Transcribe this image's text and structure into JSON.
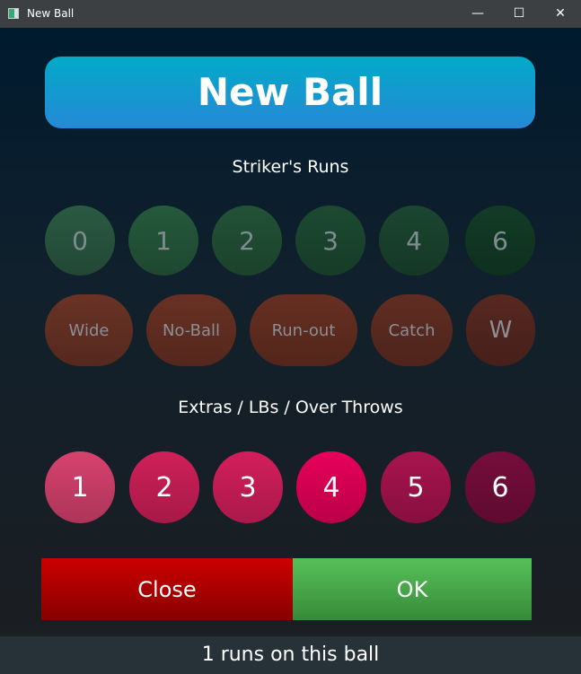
{
  "window": {
    "title": "New Ball",
    "minimize": "—",
    "maximize": "☐",
    "close": "✕"
  },
  "header": "New Ball",
  "striker_label": "Striker's Runs",
  "runs": [
    {
      "label": "0",
      "color": "#2a5a42"
    },
    {
      "label": "1",
      "color": "#255a3c"
    },
    {
      "label": "2",
      "color": "#225236"
    },
    {
      "label": "3",
      "color": "#1c4a31"
    },
    {
      "label": "4",
      "color": "#1b4630"
    },
    {
      "label": "6",
      "color": "#123c26"
    }
  ],
  "dismissals": [
    {
      "label": "Wide",
      "color": "#6a3326"
    },
    {
      "label": "No-Ball",
      "color": "#693124"
    },
    {
      "label": "Run-out",
      "color": "#672f22"
    },
    {
      "label": "Catch",
      "color": "#612d22"
    },
    {
      "label": "W",
      "color": "#572820"
    }
  ],
  "extras_label": "Extras / LBs / Over Throws",
  "extras": [
    {
      "label": "1",
      "color": "#d8426f"
    },
    {
      "label": "2",
      "color": "#d0205a"
    },
    {
      "label": "3",
      "color": "#d41f5c"
    },
    {
      "label": "4",
      "color": "#e8005a"
    },
    {
      "label": "5",
      "color": "#a8144e"
    },
    {
      "label": "6",
      "color": "#760d3c"
    }
  ],
  "actions": {
    "close": "Close",
    "ok": "OK"
  },
  "status": "1 runs on this ball"
}
